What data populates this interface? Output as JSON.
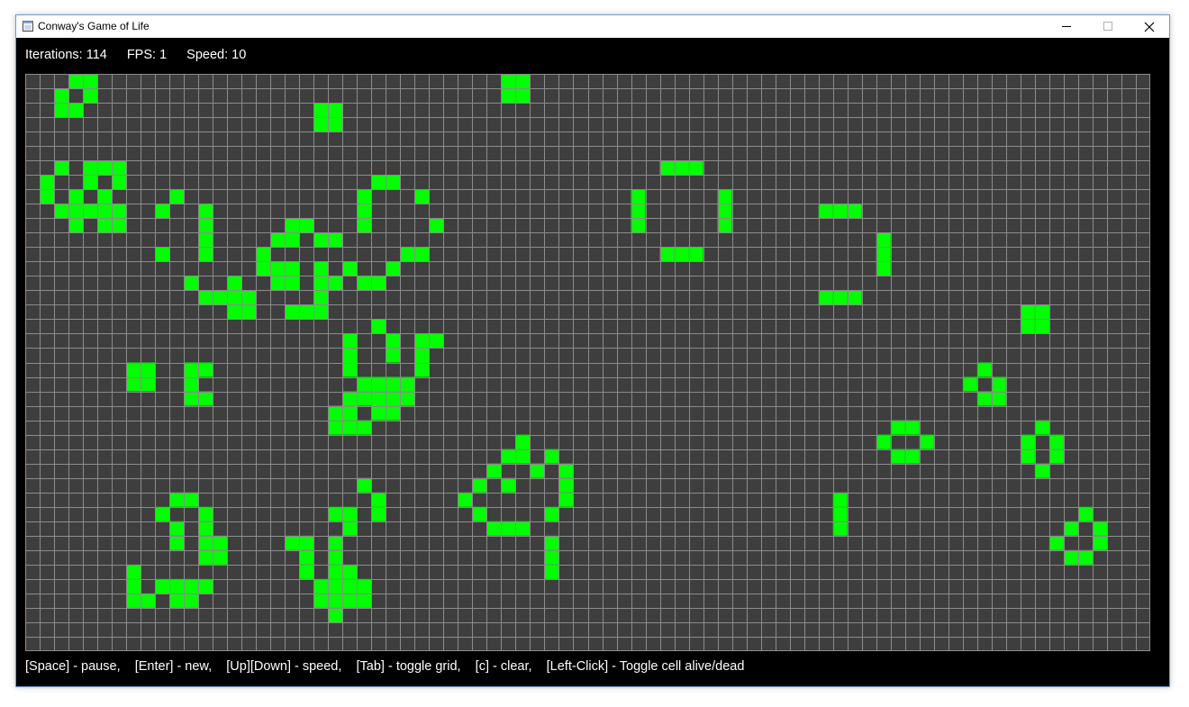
{
  "window": {
    "title": "Conway's Game of Life",
    "controls": [
      "minimize",
      "maximize",
      "close"
    ]
  },
  "status": {
    "iterations_text": "Iterations: 114",
    "fps_text": "FPS: 1",
    "speed_text": "Speed: 10"
  },
  "board": {
    "cols": 78,
    "rows": 40,
    "grid_visible": true,
    "colors": {
      "background": "#3e3e3e",
      "grid": "#8c8c8c",
      "alive": "#00ff00"
    },
    "alive_cells": [
      [
        3,
        0
      ],
      [
        4,
        0
      ],
      [
        2,
        1
      ],
      [
        4,
        1
      ],
      [
        2,
        2
      ],
      [
        3,
        2
      ],
      [
        33,
        0
      ],
      [
        34,
        0
      ],
      [
        33,
        1
      ],
      [
        34,
        1
      ],
      [
        20,
        2
      ],
      [
        21,
        2
      ],
      [
        20,
        3
      ],
      [
        21,
        3
      ],
      [
        2,
        6
      ],
      [
        4,
        6
      ],
      [
        5,
        6
      ],
      [
        6,
        6
      ],
      [
        1,
        7
      ],
      [
        4,
        7
      ],
      [
        6,
        7
      ],
      [
        1,
        8
      ],
      [
        3,
        8
      ],
      [
        5,
        8
      ],
      [
        2,
        9
      ],
      [
        3,
        9
      ],
      [
        4,
        9
      ],
      [
        5,
        9
      ],
      [
        6,
        9
      ],
      [
        3,
        10
      ],
      [
        5,
        10
      ],
      [
        6,
        10
      ],
      [
        10,
        8
      ],
      [
        9,
        9
      ],
      [
        12,
        9
      ],
      [
        12,
        10
      ],
      [
        12,
        11
      ],
      [
        9,
        12
      ],
      [
        12,
        12
      ],
      [
        11,
        14
      ],
      [
        12,
        15
      ],
      [
        13,
        15
      ],
      [
        14,
        15
      ],
      [
        14,
        14
      ],
      [
        14,
        16
      ],
      [
        15,
        16
      ],
      [
        15,
        15
      ],
      [
        24,
        7
      ],
      [
        25,
        7
      ],
      [
        23,
        8
      ],
      [
        27,
        8
      ],
      [
        23,
        9
      ],
      [
        28,
        10
      ],
      [
        23,
        10
      ],
      [
        18,
        10
      ],
      [
        19,
        10
      ],
      [
        17,
        11
      ],
      [
        18,
        11
      ],
      [
        20,
        11
      ],
      [
        21,
        11
      ],
      [
        16,
        12
      ],
      [
        26,
        12
      ],
      [
        27,
        12
      ],
      [
        16,
        13
      ],
      [
        17,
        13
      ],
      [
        18,
        13
      ],
      [
        20,
        13
      ],
      [
        22,
        13
      ],
      [
        25,
        13
      ],
      [
        17,
        14
      ],
      [
        18,
        14
      ],
      [
        20,
        14
      ],
      [
        21,
        14
      ],
      [
        23,
        14
      ],
      [
        24,
        14
      ],
      [
        20,
        15
      ],
      [
        18,
        16
      ],
      [
        19,
        16
      ],
      [
        20,
        16
      ],
      [
        24,
        17
      ],
      [
        22,
        18
      ],
      [
        25,
        18
      ],
      [
        27,
        18
      ],
      [
        28,
        18
      ],
      [
        22,
        19
      ],
      [
        25,
        19
      ],
      [
        27,
        19
      ],
      [
        22,
        20
      ],
      [
        27,
        20
      ],
      [
        23,
        21
      ],
      [
        24,
        21
      ],
      [
        25,
        21
      ],
      [
        26,
        21
      ],
      [
        22,
        22
      ],
      [
        23,
        22
      ],
      [
        24,
        22
      ],
      [
        25,
        22
      ],
      [
        26,
        22
      ],
      [
        21,
        23
      ],
      [
        22,
        23
      ],
      [
        24,
        23
      ],
      [
        25,
        23
      ],
      [
        21,
        24
      ],
      [
        22,
        24
      ],
      [
        23,
        24
      ],
      [
        7,
        20
      ],
      [
        8,
        20
      ],
      [
        11,
        20
      ],
      [
        12,
        20
      ],
      [
        7,
        21
      ],
      [
        8,
        21
      ],
      [
        11,
        21
      ],
      [
        11,
        22
      ],
      [
        12,
        22
      ],
      [
        44,
        6
      ],
      [
        45,
        6
      ],
      [
        46,
        6
      ],
      [
        42,
        8
      ],
      [
        48,
        8
      ],
      [
        42,
        9
      ],
      [
        48,
        9
      ],
      [
        42,
        10
      ],
      [
        48,
        10
      ],
      [
        44,
        12
      ],
      [
        45,
        12
      ],
      [
        46,
        12
      ],
      [
        55,
        9
      ],
      [
        56,
        9
      ],
      [
        57,
        9
      ],
      [
        59,
        11
      ],
      [
        59,
        12
      ],
      [
        59,
        13
      ],
      [
        55,
        15
      ],
      [
        56,
        15
      ],
      [
        57,
        15
      ],
      [
        69,
        16
      ],
      [
        70,
        16
      ],
      [
        69,
        17
      ],
      [
        70,
        17
      ],
      [
        66,
        20
      ],
      [
        65,
        21
      ],
      [
        67,
        21
      ],
      [
        66,
        22
      ],
      [
        67,
        22
      ],
      [
        60,
        24
      ],
      [
        61,
        24
      ],
      [
        59,
        25
      ],
      [
        62,
        25
      ],
      [
        60,
        26
      ],
      [
        61,
        26
      ],
      [
        70,
        24
      ],
      [
        69,
        25
      ],
      [
        71,
        25
      ],
      [
        69,
        26
      ],
      [
        71,
        26
      ],
      [
        70,
        27
      ],
      [
        34,
        25
      ],
      [
        33,
        26
      ],
      [
        34,
        26
      ],
      [
        36,
        26
      ],
      [
        32,
        27
      ],
      [
        35,
        27
      ],
      [
        37,
        27
      ],
      [
        31,
        28
      ],
      [
        33,
        28
      ],
      [
        37,
        28
      ],
      [
        30,
        29
      ],
      [
        37,
        29
      ],
      [
        36,
        30
      ],
      [
        31,
        30
      ],
      [
        32,
        31
      ],
      [
        33,
        31
      ],
      [
        34,
        31
      ],
      [
        36,
        32
      ],
      [
        36,
        33
      ],
      [
        36,
        34
      ],
      [
        56,
        29
      ],
      [
        56,
        30
      ],
      [
        56,
        31
      ],
      [
        73,
        30
      ],
      [
        72,
        31
      ],
      [
        74,
        31
      ],
      [
        71,
        32
      ],
      [
        74,
        32
      ],
      [
        72,
        33
      ],
      [
        73,
        33
      ],
      [
        10,
        29
      ],
      [
        11,
        29
      ],
      [
        9,
        30
      ],
      [
        12,
        30
      ],
      [
        10,
        31
      ],
      [
        12,
        31
      ],
      [
        10,
        32
      ],
      [
        12,
        32
      ],
      [
        13,
        32
      ],
      [
        12,
        33
      ],
      [
        13,
        33
      ],
      [
        7,
        34
      ],
      [
        7,
        35
      ],
      [
        9,
        35
      ],
      [
        10,
        35
      ],
      [
        11,
        35
      ],
      [
        12,
        35
      ],
      [
        7,
        36
      ],
      [
        8,
        36
      ],
      [
        10,
        36
      ],
      [
        11,
        36
      ],
      [
        23,
        28
      ],
      [
        24,
        29
      ],
      [
        24,
        30
      ],
      [
        21,
        30
      ],
      [
        22,
        30
      ],
      [
        18,
        32
      ],
      [
        19,
        32
      ],
      [
        19,
        33
      ],
      [
        19,
        34
      ],
      [
        21,
        32
      ],
      [
        22,
        31
      ],
      [
        21,
        33
      ],
      [
        21,
        34
      ],
      [
        22,
        34
      ],
      [
        22,
        35
      ],
      [
        22,
        36
      ],
      [
        20,
        35
      ],
      [
        21,
        35
      ],
      [
        20,
        36
      ],
      [
        21,
        36
      ],
      [
        23,
        35
      ],
      [
        23,
        36
      ],
      [
        21,
        37
      ]
    ]
  },
  "help": {
    "text": "[Space] - pause,    [Enter] - new,    [Up][Down] - speed,    [Tab] - toggle grid,    [c] - clear,    [Left-Click] - Toggle cell alive/dead"
  }
}
